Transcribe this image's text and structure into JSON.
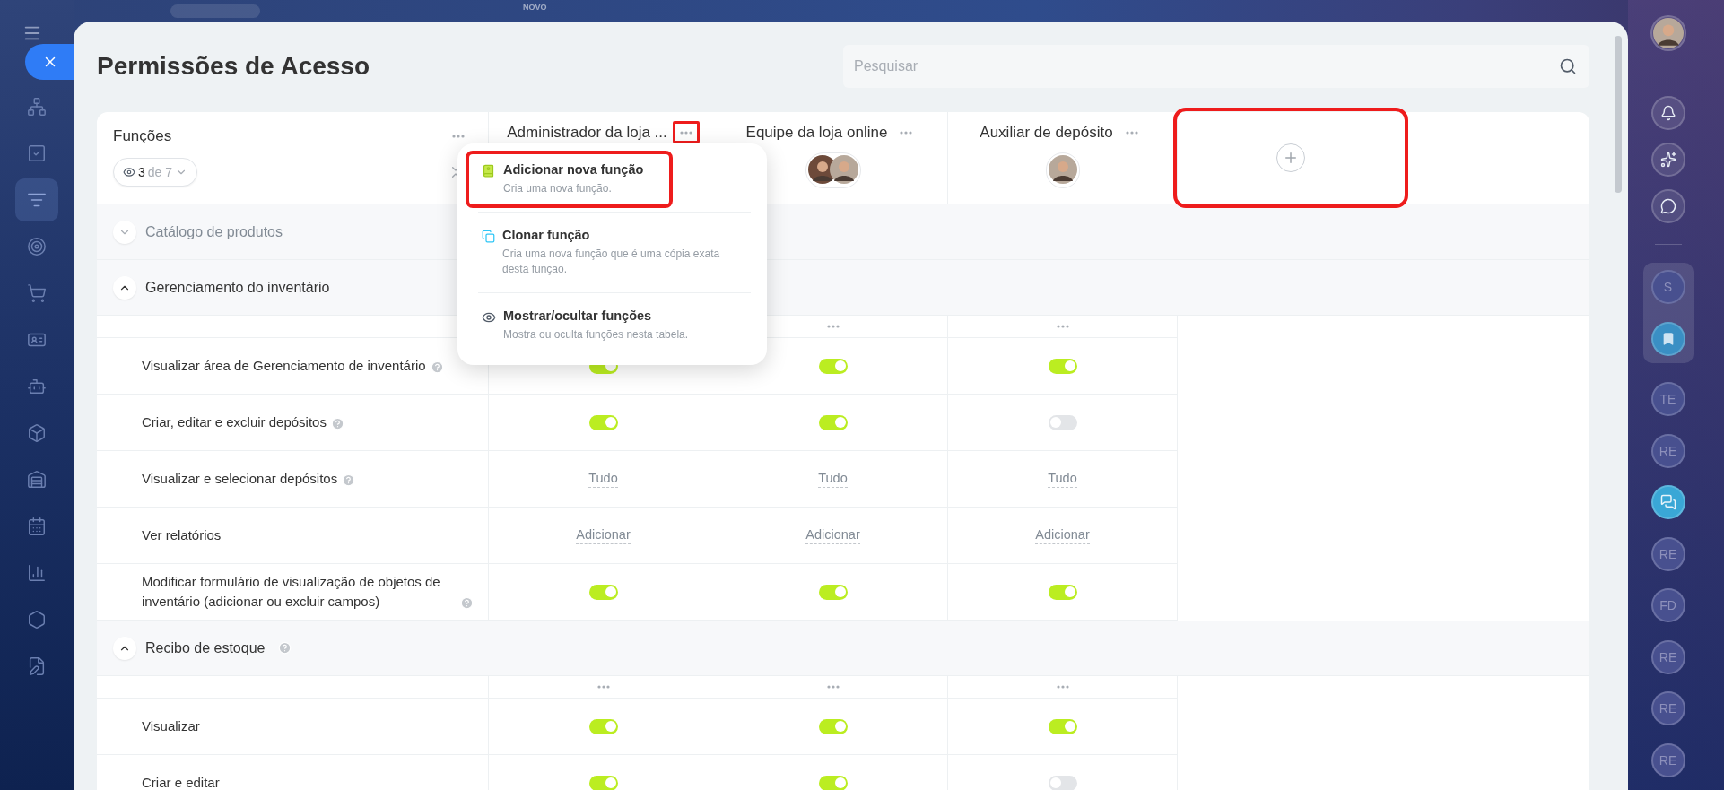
{
  "top_bar": {
    "badge": "NOVO"
  },
  "left_rail": {
    "items": [
      {
        "kind": "network",
        "selected": false
      },
      {
        "kind": "tasks",
        "selected": false
      },
      {
        "kind": "funnel",
        "selected": true
      },
      {
        "kind": "target",
        "selected": false
      },
      {
        "kind": "cart",
        "selected": false
      },
      {
        "kind": "card",
        "selected": false
      },
      {
        "kind": "robot",
        "selected": false
      },
      {
        "kind": "box",
        "selected": false
      },
      {
        "kind": "warehouse",
        "selected": false
      },
      {
        "kind": "calendar",
        "selected": false
      },
      {
        "kind": "chart",
        "selected": false
      },
      {
        "kind": "hexagon",
        "selected": false
      },
      {
        "kind": "document",
        "selected": false
      }
    ]
  },
  "page": {
    "title": "Permissões de Acesso"
  },
  "search": {
    "placeholder": "Pesquisar"
  },
  "table": {
    "first_column": {
      "title": "Funções",
      "filter": {
        "count": "3",
        "total": "de 7"
      }
    },
    "roles": [
      {
        "name": "Administrador da loja ...",
        "highlighted": true
      },
      {
        "name": "Equipe da loja online",
        "highlighted": false,
        "avatars": [
          {
            "kind": "photo"
          },
          {
            "kind": "photo"
          }
        ]
      },
      {
        "name": "Auxiliar de depósito",
        "highlighted": false,
        "avatars": [
          {
            "kind": "photo"
          }
        ]
      }
    ],
    "add_column": {
      "highlighted": true
    },
    "sections": [
      {
        "title": "Catálogo de produtos",
        "expanded": false,
        "help": false
      },
      {
        "title": "Gerenciamento do inventário",
        "expanded": true,
        "help": false,
        "column_menus": [
          {
            "shown": false
          },
          {
            "shown": true
          },
          {
            "shown": true
          }
        ],
        "rows": [
          {
            "label": "Visualizar área de Gerenciamento de inventário",
            "help": true,
            "cells": [
              {
                "kind": "toggle",
                "on": true
              },
              {
                "kind": "toggle",
                "on": true
              },
              {
                "kind": "toggle",
                "on": true
              }
            ]
          },
          {
            "label": "Criar, editar e excluir depósitos",
            "help": true,
            "cells": [
              {
                "kind": "toggle",
                "on": true
              },
              {
                "kind": "toggle",
                "on": true
              },
              {
                "kind": "toggle",
                "on": false
              }
            ]
          },
          {
            "label": "Visualizar e selecionar depósitos",
            "help": true,
            "cells": [
              {
                "kind": "link",
                "text": "Tudo"
              },
              {
                "kind": "link",
                "text": "Tudo"
              },
              {
                "kind": "link",
                "text": "Tudo"
              }
            ]
          },
          {
            "label": "Ver relatórios",
            "help": false,
            "cells": [
              {
                "kind": "link",
                "text": "Adicionar"
              },
              {
                "kind": "link",
                "text": "Adicionar"
              },
              {
                "kind": "link",
                "text": "Adicionar"
              }
            ]
          },
          {
            "label": "Modificar formulário de visualização de objetos de inventário (adicionar ou excluir campos)",
            "help": true,
            "cells": [
              {
                "kind": "toggle",
                "on": true
              },
              {
                "kind": "toggle",
                "on": true
              },
              {
                "kind": "toggle",
                "on": true
              }
            ]
          }
        ]
      },
      {
        "title": "Recibo de estoque",
        "expanded": true,
        "help": true,
        "column_menus": [
          {
            "shown": true
          },
          {
            "shown": true
          },
          {
            "shown": true
          }
        ],
        "rows": [
          {
            "label": "Visualizar",
            "help": false,
            "cells": [
              {
                "kind": "toggle",
                "on": true
              },
              {
                "kind": "toggle",
                "on": true
              },
              {
                "kind": "toggle",
                "on": true
              }
            ]
          },
          {
            "label": "Criar e editar",
            "help": false,
            "cells": [
              {
                "kind": "toggle",
                "on": true
              },
              {
                "kind": "toggle",
                "on": true
              },
              {
                "kind": "toggle",
                "on": false
              }
            ]
          }
        ]
      }
    ]
  },
  "menu": {
    "items": [
      {
        "kind": "add",
        "title": "Adicionar nova função",
        "description": "Cria uma nova função.",
        "highlighted": true
      },
      {
        "kind": "clone",
        "title": "Clonar função",
        "description": "Cria uma nova função que é uma cópia exata desta função.",
        "highlighted": false
      },
      {
        "kind": "visibility",
        "title": "Mostrar/ocultar funções",
        "description": "Mostra ou oculta funções nesta tabela.",
        "highlighted": false
      }
    ]
  },
  "right_rail": {
    "pinned": [
      {
        "kind": "initials",
        "text": "S"
      },
      {
        "kind": "bookmark"
      }
    ],
    "chats": [
      {
        "kind": "initials",
        "text": "TE"
      },
      {
        "kind": "initials",
        "text": "RE"
      },
      {
        "kind": "chat"
      },
      {
        "kind": "initials",
        "text": "RE"
      },
      {
        "kind": "initials",
        "text": "FD"
      },
      {
        "kind": "initials",
        "text": "RE"
      },
      {
        "kind": "initials",
        "text": "RE"
      },
      {
        "kind": "initials",
        "text": "RE"
      }
    ]
  }
}
